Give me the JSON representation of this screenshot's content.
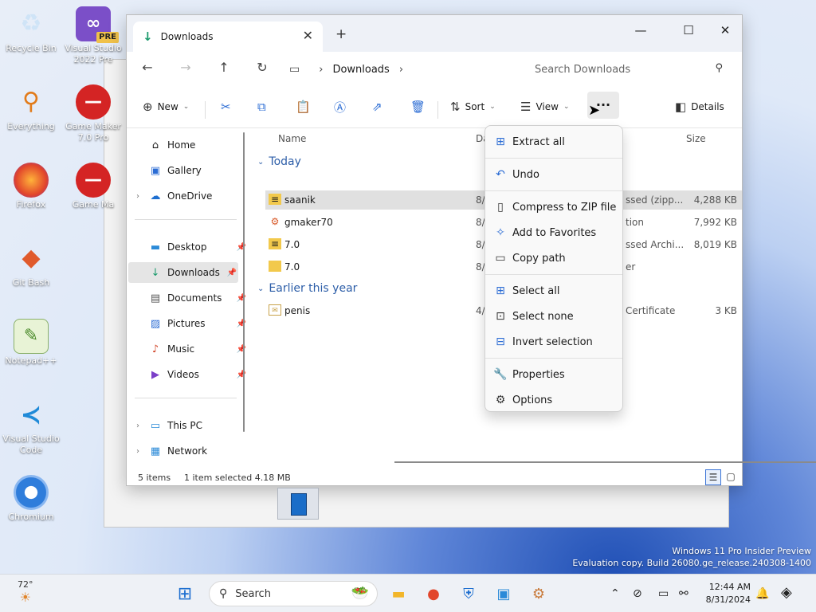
{
  "desktop": {
    "icons": [
      {
        "label": "Recycle Bin",
        "icon": "recycle-bin-icon"
      },
      {
        "label": "Visual Studio 2022 Pre",
        "icon": "visual-studio-icon",
        "badge": "PRE"
      },
      {
        "label": "Everything",
        "icon": "everything-search-icon"
      },
      {
        "label": "Game Maker 7.0 Pro",
        "icon": "game-maker-icon"
      },
      {
        "label": "Firefox",
        "icon": "firefox-icon"
      },
      {
        "label": "Game Ma",
        "icon": "game-maker-icon"
      },
      {
        "label": "Git Bash",
        "icon": "git-bash-icon"
      },
      {
        "label": "Notepad++",
        "icon": "notepadpp-icon"
      },
      {
        "label": "Visual Studio Code",
        "icon": "vscode-icon"
      },
      {
        "label": "Chromium",
        "icon": "chromium-icon"
      }
    ]
  },
  "explorer": {
    "tab": {
      "label": "Downloads"
    },
    "address": {
      "path": [
        "Downloads"
      ]
    },
    "search": {
      "placeholder": "Search Downloads"
    },
    "commands": {
      "new": "New",
      "sort": "Sort",
      "view": "View",
      "more": "···",
      "details": "Details"
    },
    "sidebar": {
      "items": [
        {
          "label": "Home",
          "icon": "home-icon"
        },
        {
          "label": "Gallery",
          "icon": "gallery-icon"
        },
        {
          "label": "OneDrive",
          "icon": "onedrive-icon"
        },
        {
          "label": "Desktop",
          "icon": "desktop-folder-icon",
          "pinned": true
        },
        {
          "label": "Downloads",
          "icon": "downloads-folder-icon",
          "pinned": true,
          "selected": true
        },
        {
          "label": "Documents",
          "icon": "documents-folder-icon",
          "pinned": true
        },
        {
          "label": "Pictures",
          "icon": "pictures-folder-icon",
          "pinned": true
        },
        {
          "label": "Music",
          "icon": "music-folder-icon",
          "pinned": true
        },
        {
          "label": "Videos",
          "icon": "videos-folder-icon",
          "pinned": true
        },
        {
          "label": "This PC",
          "icon": "this-pc-icon"
        },
        {
          "label": "Network",
          "icon": "network-icon"
        }
      ]
    },
    "columns": {
      "name": "Name",
      "date": "Da",
      "size": "Size"
    },
    "groups": [
      {
        "label": "Today",
        "files": [
          {
            "name": "saanik",
            "date": "8/",
            "type": "ssed (zipp...",
            "size": "4,288 KB",
            "icon": "zip-folder-icon",
            "selected": true
          },
          {
            "name": "gmaker70",
            "date": "8/",
            "type": "tion",
            "size": "7,992 KB",
            "icon": "installer-icon"
          },
          {
            "name": "7.0",
            "date": "8/",
            "type": "ssed Archi...",
            "size": "8,019 KB",
            "icon": "zip-folder-icon"
          },
          {
            "name": "7.0",
            "date": "8/",
            "type": "er",
            "size": "",
            "icon": "folder-icon"
          }
        ]
      },
      {
        "label": "Earlier this year",
        "files": [
          {
            "name": "penis",
            "date": "4/",
            "type": "Certificate",
            "size": "3 KB",
            "icon": "certificate-icon"
          }
        ]
      }
    ],
    "status": {
      "item_count": "5 items",
      "selection": "1 item selected  4.18 MB"
    }
  },
  "context_menu": {
    "items": [
      {
        "label": "Extract all",
        "icon": "extract-all-icon"
      },
      {
        "label": "Undo",
        "icon": "undo-icon"
      },
      {
        "label": "Compress to ZIP file",
        "icon": "compress-zip-icon"
      },
      {
        "label": "Add to Favorites",
        "icon": "favorite-star-icon"
      },
      {
        "label": "Copy path",
        "icon": "copy-path-icon"
      },
      {
        "label": "Select all",
        "icon": "select-all-icon"
      },
      {
        "label": "Select none",
        "icon": "select-none-icon"
      },
      {
        "label": "Invert selection",
        "icon": "invert-selection-icon"
      },
      {
        "label": "Properties",
        "icon": "properties-icon"
      },
      {
        "label": "Options",
        "icon": "options-gear-icon"
      }
    ]
  },
  "watermark": {
    "line1": "Windows 11 Pro Insider Preview",
    "line2": "Evaluation copy. Build 26080.ge_release.240308-1400"
  },
  "taskbar": {
    "weather": {
      "temp": "72°"
    },
    "search": {
      "label": "Search"
    },
    "clock": {
      "time": "12:44 AM",
      "date": "8/31/2024"
    }
  }
}
